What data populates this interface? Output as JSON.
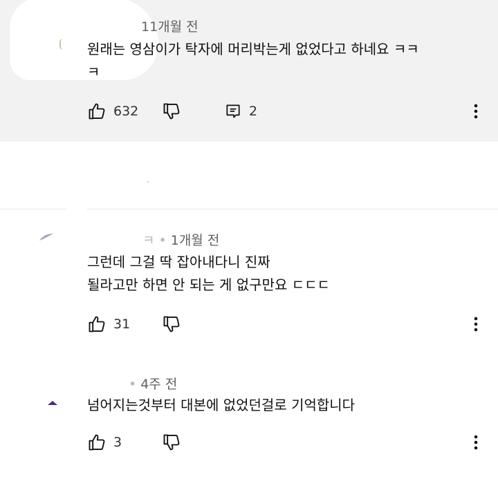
{
  "comments": [
    {
      "time": "11개월 전",
      "text": "원래는 영삼이가 탁자에 머리박는게 없었다고 하네요 ㅋㅋ\nㅋ",
      "likes": "632",
      "replies": "2"
    },
    {
      "time": "1개월 전",
      "name_fragment": "ㅋ •",
      "text": "그런데 그걸 딱 잡아내다니 진짜\n될라고만 하면 안 되는 게 없구만요 ㄷㄷㄷ",
      "likes": "31"
    },
    {
      "time": "4주 전",
      "name_fragment": "•",
      "text": "넘어지는것부터 대본에 없었던걸로 기억합니다",
      "likes": "3"
    }
  ],
  "colors": {
    "highlight_bg": "#f2f2f2",
    "text": "#0f0f0f",
    "meta": "#606060",
    "divider": "#e5e5e5"
  }
}
